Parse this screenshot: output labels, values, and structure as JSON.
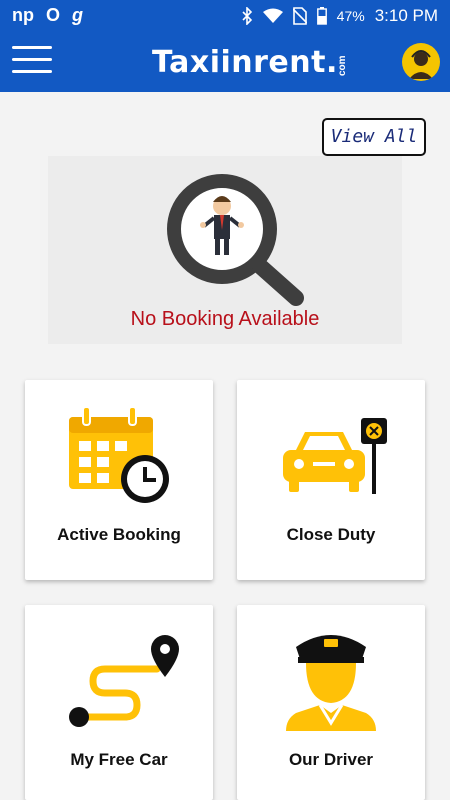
{
  "status_bar": {
    "left_icons": [
      "np",
      "O",
      "g"
    ],
    "battery": "47%",
    "time": "3:10 PM"
  },
  "app_bar": {
    "logo_text": "Taxiinrent.",
    "logo_suffix": "com"
  },
  "booking": {
    "view_all_label": "View All",
    "empty_message": "No Booking Available"
  },
  "cards": [
    {
      "label": "Active Booking",
      "icon": "calendar-clock-icon"
    },
    {
      "label": "Close Duty",
      "icon": "taxi-stop-icon"
    },
    {
      "label": "My Free Car",
      "icon": "route-pin-icon"
    },
    {
      "label": "Our Driver",
      "icon": "driver-icon"
    }
  ],
  "colors": {
    "primary": "#1259c3",
    "accent_yellow": "#ffc107",
    "empty_text": "#b8101a"
  }
}
